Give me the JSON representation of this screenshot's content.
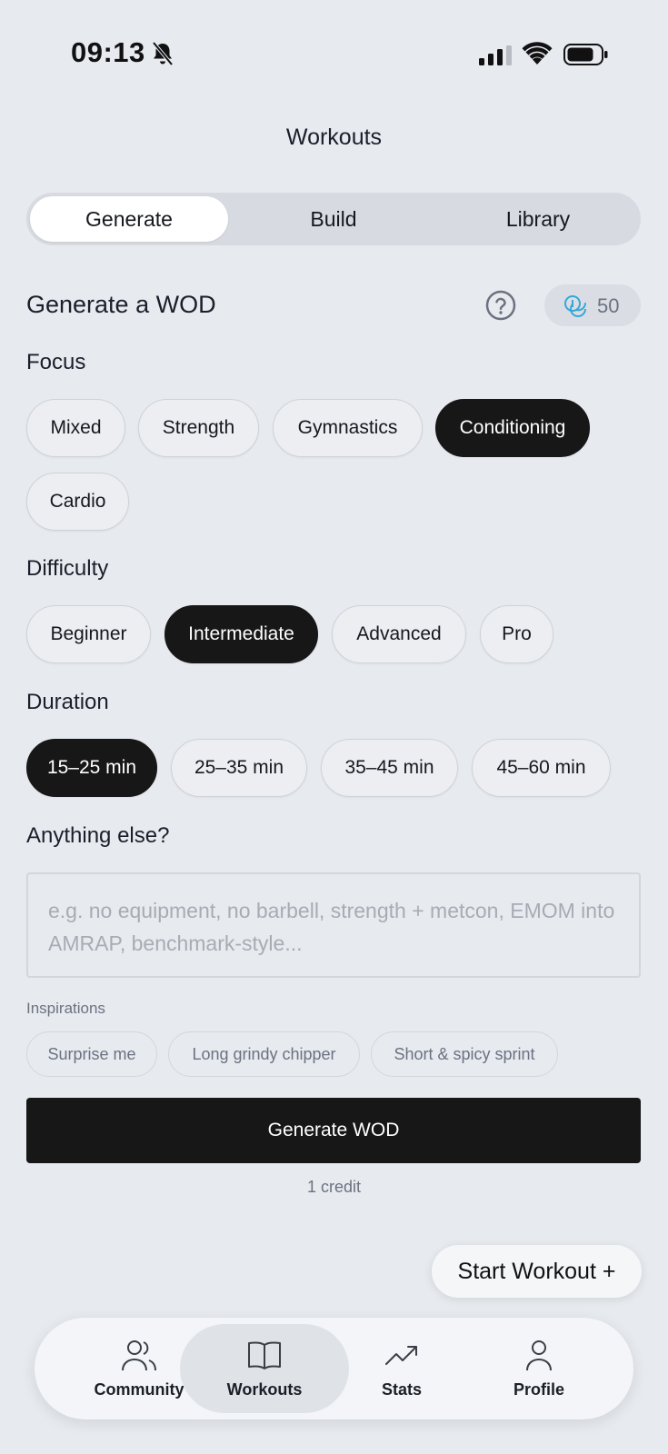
{
  "status_bar": {
    "time": "09:13"
  },
  "header": {
    "title": "Workouts"
  },
  "segments": {
    "items": [
      "Generate",
      "Build",
      "Library"
    ],
    "active": "Generate"
  },
  "generator": {
    "title": "Generate a WOD",
    "credits": "50"
  },
  "focus": {
    "label": "Focus",
    "options": [
      "Mixed",
      "Strength",
      "Gymnastics",
      "Conditioning",
      "Cardio"
    ],
    "selected": "Conditioning"
  },
  "difficulty": {
    "label": "Difficulty",
    "options": [
      "Beginner",
      "Intermediate",
      "Advanced",
      "Pro"
    ],
    "selected": "Intermediate"
  },
  "duration": {
    "label": "Duration",
    "options": [
      "15–25 min",
      "25–35 min",
      "35–45 min",
      "45–60 min"
    ],
    "selected": "15–25 min"
  },
  "notes": {
    "label": "Anything else?",
    "value": "",
    "placeholder": "e.g. no equipment, no barbell, strength + metcon, EMOM into AMRAP, benchmark-style..."
  },
  "inspirations": {
    "label": "Inspirations",
    "items": [
      "Surprise me",
      "Long grindy chipper",
      "Short & spicy sprint"
    ]
  },
  "actions": {
    "generate_label": "Generate WOD",
    "cost_note": "1 credit",
    "start_workout_label": "Start Workout +"
  },
  "tab_bar": {
    "items": [
      "Community",
      "Workouts",
      "Stats",
      "Profile"
    ],
    "active": "Workouts"
  },
  "colors": {
    "background": "#e7eaef",
    "selected_chip": "#171717",
    "coin_accent": "#38a6d6"
  }
}
